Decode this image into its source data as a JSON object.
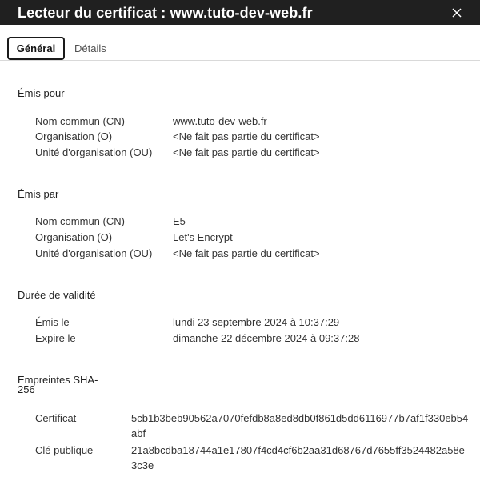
{
  "window": {
    "title": "Lecteur du certificat : www.tuto-dev-web.fr",
    "close_icon": "close-icon"
  },
  "tabs": [
    {
      "label": "Général",
      "active": true
    },
    {
      "label": "Détails",
      "active": false
    }
  ],
  "issued_to": {
    "title": "Émis pour",
    "rows": [
      {
        "label": "Nom commun (CN)",
        "value": "www.tuto-dev-web.fr"
      },
      {
        "label": "Organisation (O)",
        "value": "<Ne fait pas partie du certificat>"
      },
      {
        "label": "Unité d'organisation (OU)",
        "value": "<Ne fait pas partie du certificat>"
      }
    ]
  },
  "issued_by": {
    "title": "Émis par",
    "rows": [
      {
        "label": "Nom commun (CN)",
        "value": "E5"
      },
      {
        "label": "Organisation (O)",
        "value": "Let's Encrypt"
      },
      {
        "label": "Unité d'organisation (OU)",
        "value": "<Ne fait pas partie du certificat>"
      }
    ]
  },
  "validity": {
    "title": "Durée de validité",
    "rows": [
      {
        "label": "Émis le",
        "value": "lundi 23 septembre 2024 à 10:37:29"
      },
      {
        "label": "Expire le",
        "value": "dimanche 22 décembre 2024 à 09:37:28"
      }
    ]
  },
  "fingerprints": {
    "title": "Empreintes SHA-256",
    "rows": [
      {
        "label": "Certificat",
        "value": "5cb1b3beb90562a7070fefdb8a8ed8db0f861d5dd6116977b7af1f330eb54abf"
      },
      {
        "label": "Clé publique",
        "value": "21a8bcdba18744a1e17807f4cd4cf6b2aa31d68767d7655ff3524482a58e3c3e"
      }
    ]
  }
}
